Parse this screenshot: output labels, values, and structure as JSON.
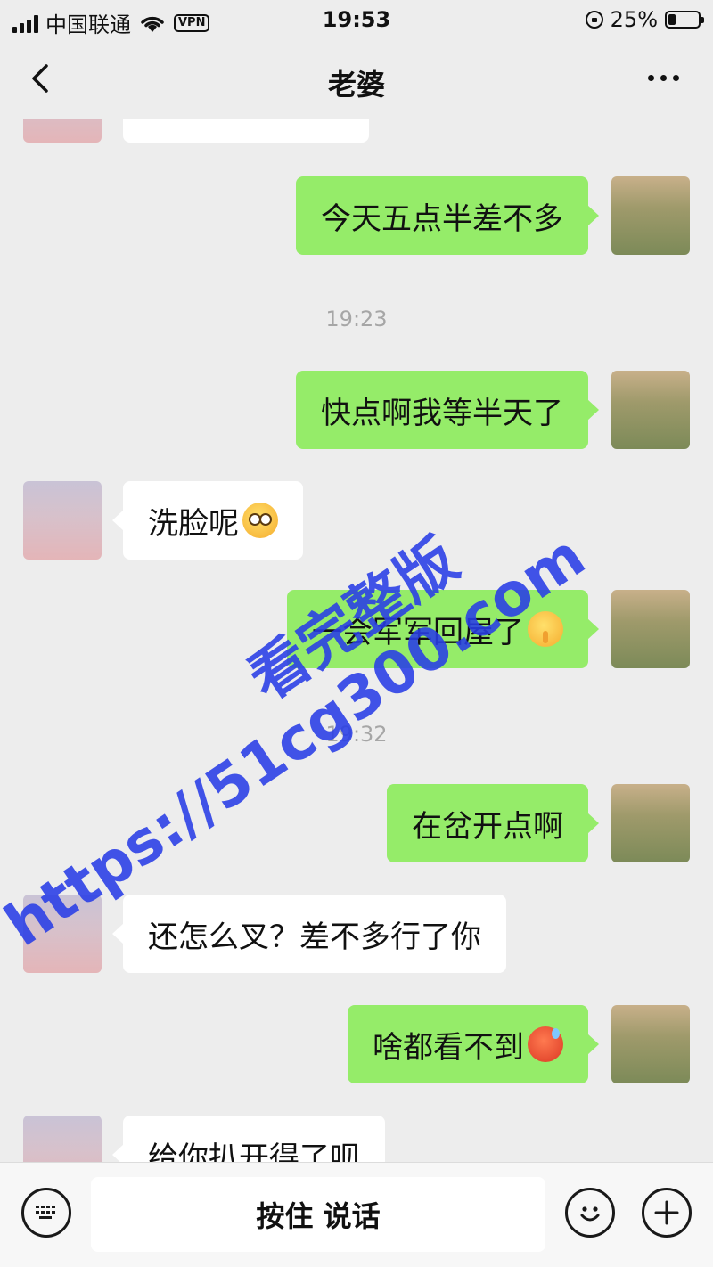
{
  "status_bar": {
    "carrier": "中国联通",
    "vpn": "VPN",
    "time": "19:53",
    "battery_percent": "25%",
    "battery_level": 0.25
  },
  "nav": {
    "title": "老婆",
    "back_icon": "chevron-left-icon",
    "more_icon": "more-dots-icon"
  },
  "messages": [
    {
      "type": "incoming",
      "text": ""
    },
    {
      "type": "outgoing",
      "text": "今天五点半差不多"
    },
    {
      "type": "time",
      "text": "19:23"
    },
    {
      "type": "outgoing",
      "text": "快点啊我等半天了"
    },
    {
      "type": "incoming",
      "text": "洗脸呢",
      "emoji": "flushed-face-icon"
    },
    {
      "type": "outgoing",
      "text": "一会军军回屋了",
      "emoji": "shushing-face-icon"
    },
    {
      "type": "time",
      "text": "19:32"
    },
    {
      "type": "outgoing",
      "text": "在岔开点啊"
    },
    {
      "type": "incoming",
      "text": "还怎么叉？差不多行了你"
    },
    {
      "type": "outgoing",
      "text": "啥都看不到",
      "emoji": "hot-face-icon"
    },
    {
      "type": "incoming",
      "text": "给你扒开得了呗"
    }
  ],
  "watermark": {
    "url": "https://51cg300.com",
    "subtitle": "看完整版"
  },
  "input_bar": {
    "hold_to_talk": "按住 说话",
    "keyboard_icon": "keyboard-icon",
    "emoji_icon": "smiley-icon",
    "plus_icon": "plus-icon"
  },
  "colors": {
    "background": "#ededed",
    "outgoing_bubble": "#95ec69",
    "incoming_bubble": "#ffffff",
    "watermark": "#283ce6"
  }
}
